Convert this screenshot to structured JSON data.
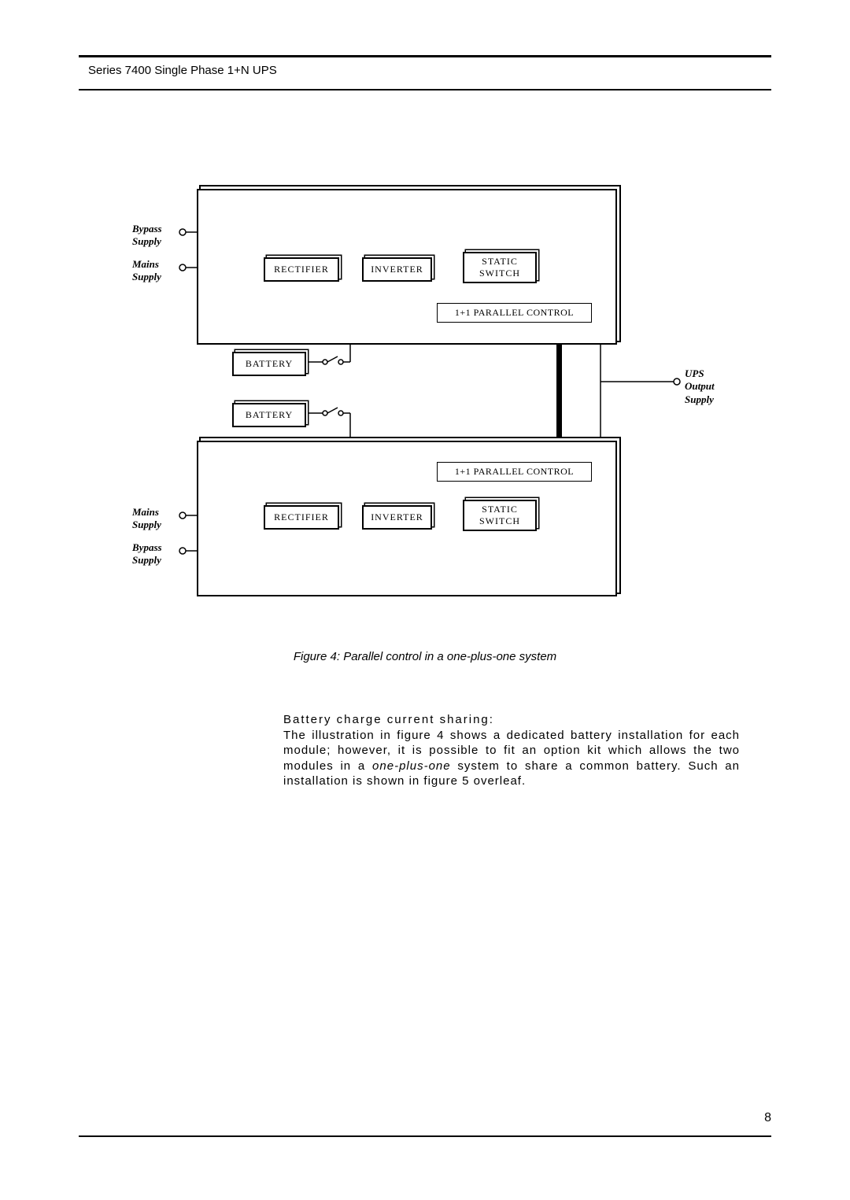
{
  "header": {
    "title": "Series 7400 Single Phase 1+N UPS"
  },
  "diagram": {
    "labels": {
      "bypass": "Bypass\nSupply",
      "mains": "Mains\nSupply",
      "output": "UPS\nOutput\nSupply"
    },
    "blocks": {
      "rectifier": "RECTIFIER",
      "inverter": "INVERTER",
      "static_switch_line1": "STATIC",
      "static_switch_line2": "SWITCH",
      "parallel_control": "1+1 PARALLEL CONTROL",
      "battery": "BATTERY"
    }
  },
  "figure": {
    "caption": "Figure 4: Parallel control in a one-plus-one system"
  },
  "body": {
    "heading": "Battery charge current sharing:",
    "p1a": "The illustration in figure 4 shows a dedicated battery installation for each module; however, it is possible to fit an option kit which allows the two modules in a ",
    "p1b": "one-plus-one",
    "p1c": " system to share a common battery.  Such an installation is shown in figure 5 overleaf."
  },
  "page_number": "8"
}
